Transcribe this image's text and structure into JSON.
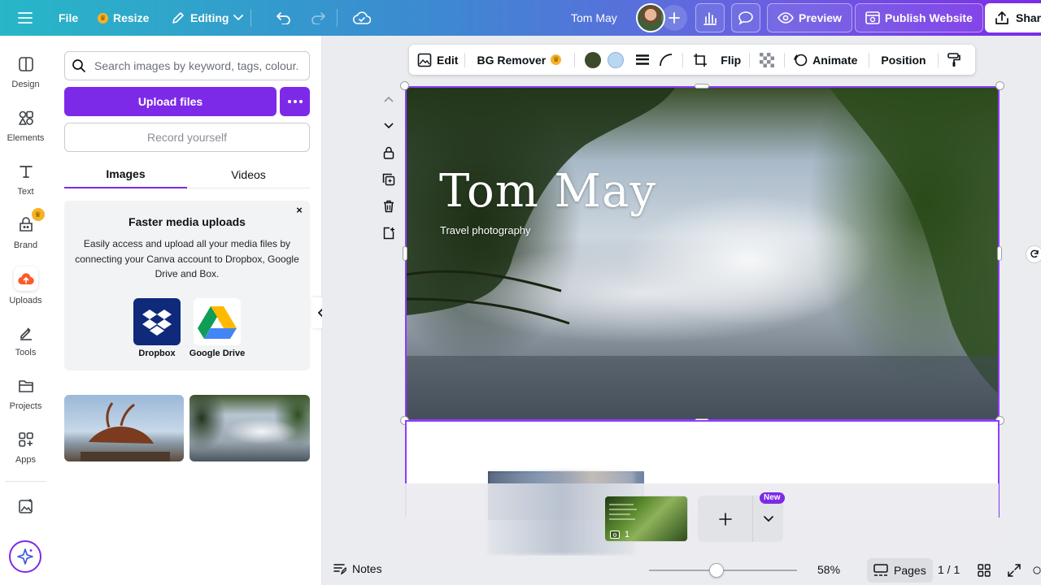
{
  "topbar": {
    "file_label": "File",
    "resize_label": "Resize",
    "editing_label": "Editing",
    "design_title": "Tom May",
    "preview_label": "Preview",
    "publish_label": "Publish Website",
    "share_label": "Share"
  },
  "rail": {
    "items": [
      {
        "label": "Design"
      },
      {
        "label": "Elements"
      },
      {
        "label": "Text"
      },
      {
        "label": "Brand"
      },
      {
        "label": "Uploads"
      },
      {
        "label": "Tools"
      },
      {
        "label": "Projects"
      },
      {
        "label": "Apps"
      }
    ]
  },
  "panel": {
    "search_placeholder": "Search images by keyword, tags, colour...",
    "upload_label": "Upload files",
    "record_label": "Record yourself",
    "tabs": [
      {
        "label": "Images"
      },
      {
        "label": "Videos"
      }
    ],
    "promo": {
      "title": "Faster media uploads",
      "body": "Easily access and upload all your media files by connecting your Canva account to Dropbox, Google Drive and Box.",
      "close": "×",
      "services": [
        {
          "label": "Dropbox"
        },
        {
          "label": "Google Drive"
        }
      ]
    }
  },
  "toolbar": {
    "edit_label": "Edit",
    "bg_remover_label": "BG Remover",
    "flip_label": "Flip",
    "animate_label": "Animate",
    "position_label": "Position",
    "swatch_colors": [
      "#3b4a2a",
      "#b9d6f2"
    ]
  },
  "canvas": {
    "title": "Tom May",
    "subtitle": "Travel photography"
  },
  "strip": {
    "thumb_page_number": "1",
    "new_badge": "New"
  },
  "bottombar": {
    "notes_label": "Notes",
    "zoom": "58%",
    "pages_label": "Pages",
    "page_count": "1 / 1"
  },
  "colors": {
    "accent": "#7d2ae8",
    "selection": "#8b3dff"
  }
}
